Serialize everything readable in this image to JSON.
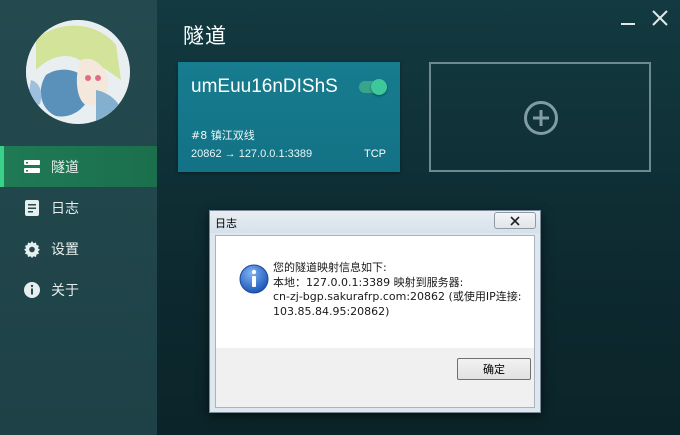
{
  "sidebar": {
    "items": [
      {
        "label": "隧道",
        "icon": "server-icon",
        "active": true
      },
      {
        "label": "日志",
        "icon": "document-icon",
        "active": false
      },
      {
        "label": "设置",
        "icon": "gear-icon",
        "active": false
      },
      {
        "label": "关于",
        "icon": "info-icon",
        "active": false
      }
    ]
  },
  "main": {
    "title": "隧道",
    "tunnel": {
      "name": "umEuu16nDIShS",
      "enabled": true,
      "node": "#8 镇江双线",
      "mapping": "20862 → 127.0.0.1:3389",
      "protocol": "TCP"
    },
    "add_card": {
      "icon": "plus-circle-icon"
    }
  },
  "window": {
    "minimize_icon": "minimize-icon",
    "close_icon": "close-icon"
  },
  "dialog": {
    "title": "日志",
    "lines": [
      "您的隧道映射信息如下:",
      "本地：127.0.0.1:3389 映射到服务器:",
      "cn-zj-bgp.sakurafrp.com:20862 (或使用IP连接:",
      "103.85.84.95:20862)"
    ],
    "ok_label": "确定"
  },
  "colors": {
    "sidebar_bg": "#244a4f",
    "active_nav": "#1f7a55",
    "tunnel_card": "#177c8f",
    "toggle_on": "#3ec79b",
    "main_bg": "#0f2d33"
  }
}
